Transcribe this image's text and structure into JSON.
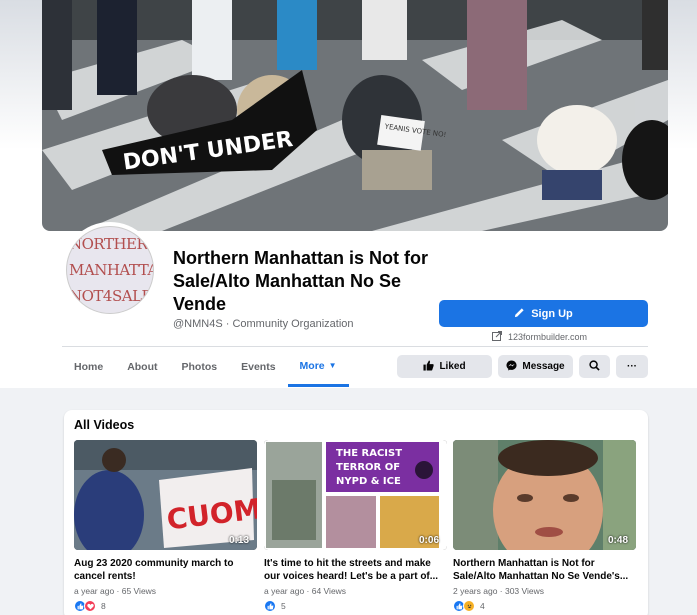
{
  "page": {
    "title": "Northern Manhattan is Not for Sale/Alto Manhattan No Se Vende",
    "handle": "@NMN4S · Community Organization",
    "avatar_lines": [
      "NORTHERN",
      "MANHATTAN",
      "NOT4SALE"
    ],
    "cover_banner_text": "DON'T UNDER",
    "cover_sign_text": "YEANIS VOTE NO!"
  },
  "actions": {
    "signup_label": "Sign Up",
    "signup_domain": "123formbuilder.com",
    "liked_label": "Liked",
    "message_label": "Message",
    "more_glyph": "···"
  },
  "nav": {
    "items": [
      "Home",
      "About",
      "Photos",
      "Events",
      "More"
    ],
    "more_caret": "▼"
  },
  "videos": {
    "section_title": "All Videos",
    "items": [
      {
        "duration": "0:13",
        "title": "Aug 23 2020 community march to cancel rents!",
        "meta": "a year ago · 65 Views",
        "reactions": "8",
        "thumb_text": "CUOMO"
      },
      {
        "duration": "0:06",
        "title": "It's time to hit the streets and make our voices heard! Let's be a part of...",
        "meta": "a year ago · 64 Views",
        "reactions": "5",
        "thumb_lines": [
          "THE RACIST",
          "TERROR OF",
          "NYPD & ICE"
        ]
      },
      {
        "duration": "0:48",
        "title": "Northern Manhattan is Not for Sale/Alto Manhattan No Se Vende's...",
        "meta": "2 years ago · 303 Views",
        "reactions": "4"
      }
    ]
  },
  "colors": {
    "accent": "#1b74e4",
    "text_secondary": "#65676b",
    "background": "#f0f2f5"
  }
}
